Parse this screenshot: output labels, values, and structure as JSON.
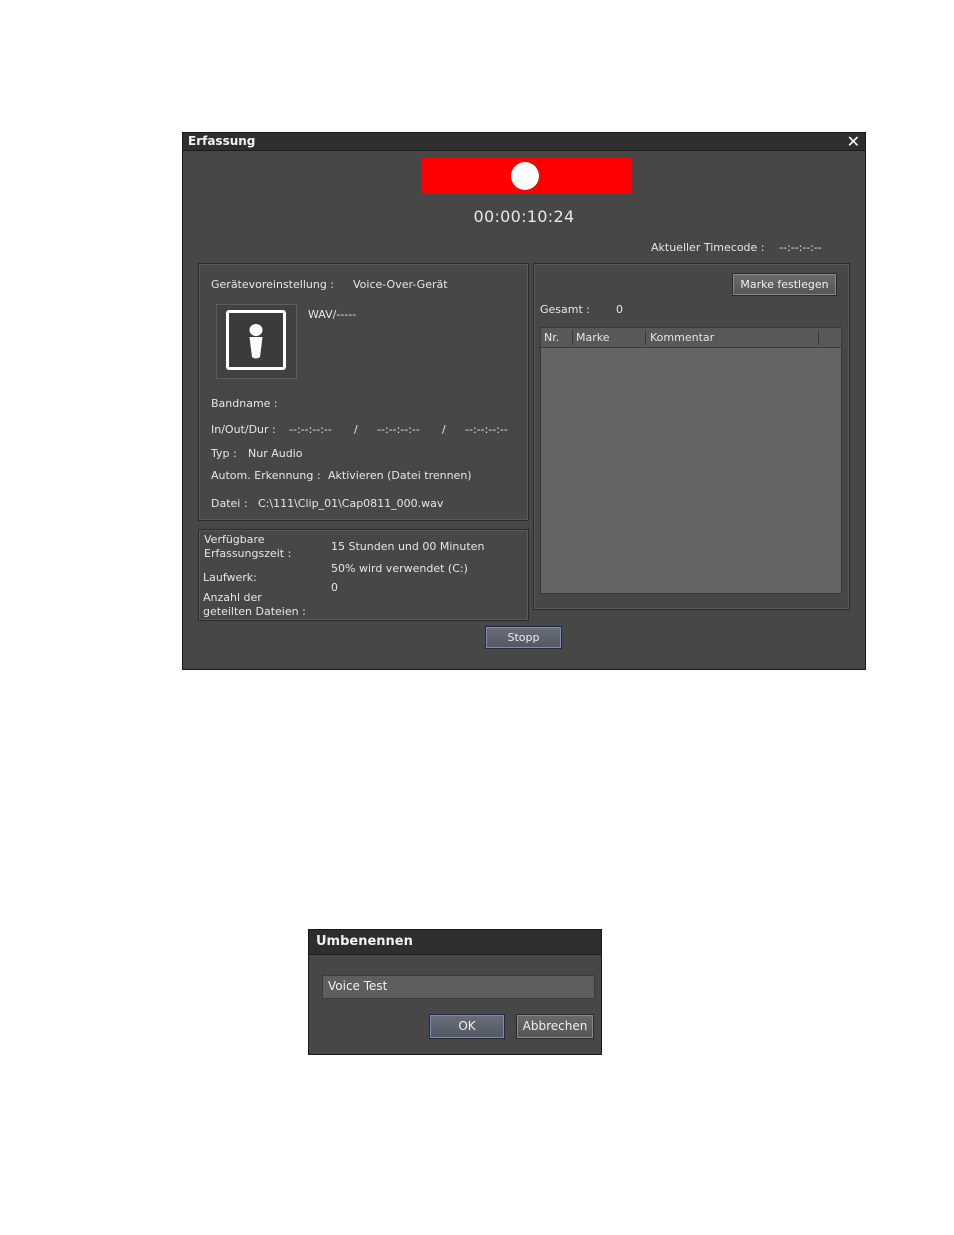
{
  "capture": {
    "title": "Erfassung",
    "timecode": "00:00:10:24",
    "current_timecode_label": "Aktueller Timecode :",
    "current_timecode_value": "--:--:--:--",
    "device_preset_label": "Gerätevoreinstellung :",
    "device_preset_value": "Voice-Over-Gerät",
    "format": "WAV/-----",
    "tape_name_label": "Bandname :",
    "inoutdur_label": "In/Out/Dur :",
    "in_value": "--:--:--:--",
    "out_value": "--:--:--:--",
    "dur_value": "--:--:--:--",
    "separator": "/",
    "type_label": "Typ :",
    "type_value": "Nur Audio",
    "auto_detect_label": "Autom. Erkennung :",
    "auto_detect_value": "Aktivieren (Datei trennen)",
    "file_label": "Datei :",
    "file_value": "C:\\111\\Clip_01\\Cap0811_000.wav",
    "available_time_label_1": "Verfügbare",
    "available_time_label_2": "Erfassungszeit :",
    "available_time_value": "15 Stunden und 00 Minuten",
    "drive_label": "Laufwerk:",
    "drive_value": "50% wird verwendet (C:)",
    "split_files_label_1": "Anzahl der",
    "split_files_label_2": "geteilten Dateien :",
    "split_files_value": "0",
    "set_marker_button": "Marke festlegen",
    "total_label": "Gesamt :",
    "total_value": "0",
    "columns": [
      "Nr.",
      "Marke",
      "Kommentar"
    ],
    "stop_button": "Stopp",
    "record_color": "#ff0000"
  },
  "rename": {
    "title": "Umbenennen",
    "input_value": "Voice Test",
    "ok_button": "OK",
    "cancel_button": "Abbrechen"
  }
}
